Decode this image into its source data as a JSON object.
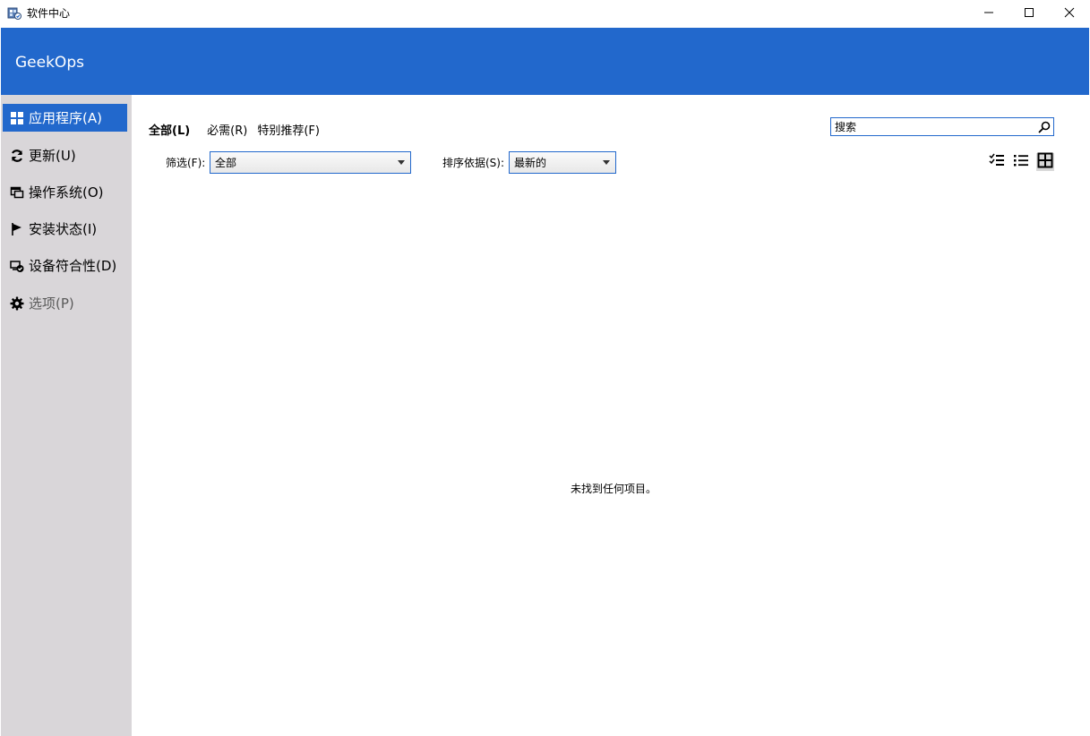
{
  "window": {
    "title": "软件中心",
    "minimize_icon": "minimize-icon",
    "maximize_icon": "maximize-icon",
    "close_icon": "close-icon"
  },
  "header": {
    "brand": "GeekOps",
    "color": "#2268cc"
  },
  "sidebar": {
    "items": [
      {
        "label": "应用程序(A)",
        "icon": "apps-grid-icon",
        "active": true
      },
      {
        "label": "更新(U)",
        "icon": "refresh-icon"
      },
      {
        "label": "操作系统(O)",
        "icon": "windows-stack-icon"
      },
      {
        "label": "安装状态(I)",
        "icon": "flag-icon"
      },
      {
        "label": "设备符合性(D)",
        "icon": "device-check-icon"
      },
      {
        "label": "选项(P)",
        "icon": "gear-icon",
        "disabled": true
      }
    ]
  },
  "main": {
    "tabs": [
      {
        "label": "全部(L)",
        "selected": true
      },
      {
        "label": "必需(R)"
      },
      {
        "label": "特别推荐(F)"
      }
    ],
    "search": {
      "placeholder": "搜索",
      "icon": "search-icon"
    },
    "filter": {
      "label": "筛选(F):",
      "value": "全部"
    },
    "sort": {
      "label": "排序依据(S):",
      "value": "最新的"
    },
    "views": [
      {
        "icon": "checklist-view-icon"
      },
      {
        "icon": "list-view-icon"
      },
      {
        "icon": "tile-view-icon",
        "selected": true
      }
    ],
    "empty_message": "未找到任何项目。"
  }
}
